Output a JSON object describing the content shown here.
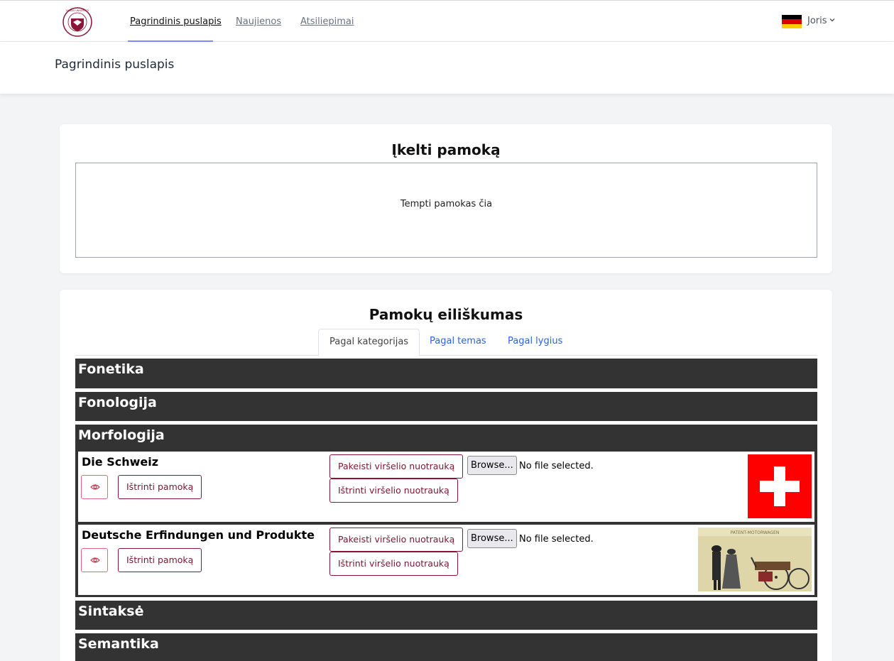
{
  "nav": {
    "links": [
      {
        "label": "Pagrindinis puslapis",
        "active": true
      },
      {
        "label": "Naujienos",
        "active": false
      },
      {
        "label": "Atsiliepimai",
        "active": false
      }
    ],
    "user": {
      "name": "Joris",
      "flag_icon": "germany-flag-icon"
    }
  },
  "header": {
    "title": "Pagrindinis puslapis"
  },
  "upload": {
    "title": "Įkelti pamoką",
    "dropzone_text": "Tempti pamokas čia"
  },
  "order": {
    "title": "Pamokų eiliškumas",
    "tabs": [
      {
        "label": "Pagal kategorijas",
        "active": true
      },
      {
        "label": "Pagal temas",
        "active": false
      },
      {
        "label": "Pagal lygius",
        "active": false
      }
    ],
    "categories": [
      {
        "name": "Fonetika"
      },
      {
        "name": "Fonologija"
      },
      {
        "name": "Morfologija"
      },
      {
        "name": "Sintaksė"
      },
      {
        "name": "Semantika"
      }
    ],
    "lessons": [
      {
        "title": "Die Schweiz",
        "view_icon": "eye-icon",
        "delete_label": "Ištrinti pamoką",
        "change_cover_label": "Pakeisti viršelio nuotrauką",
        "browse_label": "Browse...",
        "file_status": "No file selected.",
        "delete_cover_label": "Ištrinti viršelio nuotrauką",
        "cover": "swiss-flag-image"
      },
      {
        "title": "Deutsche Erfindungen und Produkte",
        "view_icon": "eye-icon",
        "delete_label": "Ištrinti pamoką",
        "change_cover_label": "Pakeisti viršelio nuotrauką",
        "browse_label": "Browse...",
        "file_status": "No file selected.",
        "delete_cover_label": "Ištrinti viršelio nuotrauką",
        "cover": "patent-motorwagen-photo",
        "cover_text": "PATENT-MOTORWAGEN"
      }
    ]
  },
  "colors": {
    "accent": "#8b1538",
    "link": "#2563eb",
    "category_bg": "#333333"
  }
}
